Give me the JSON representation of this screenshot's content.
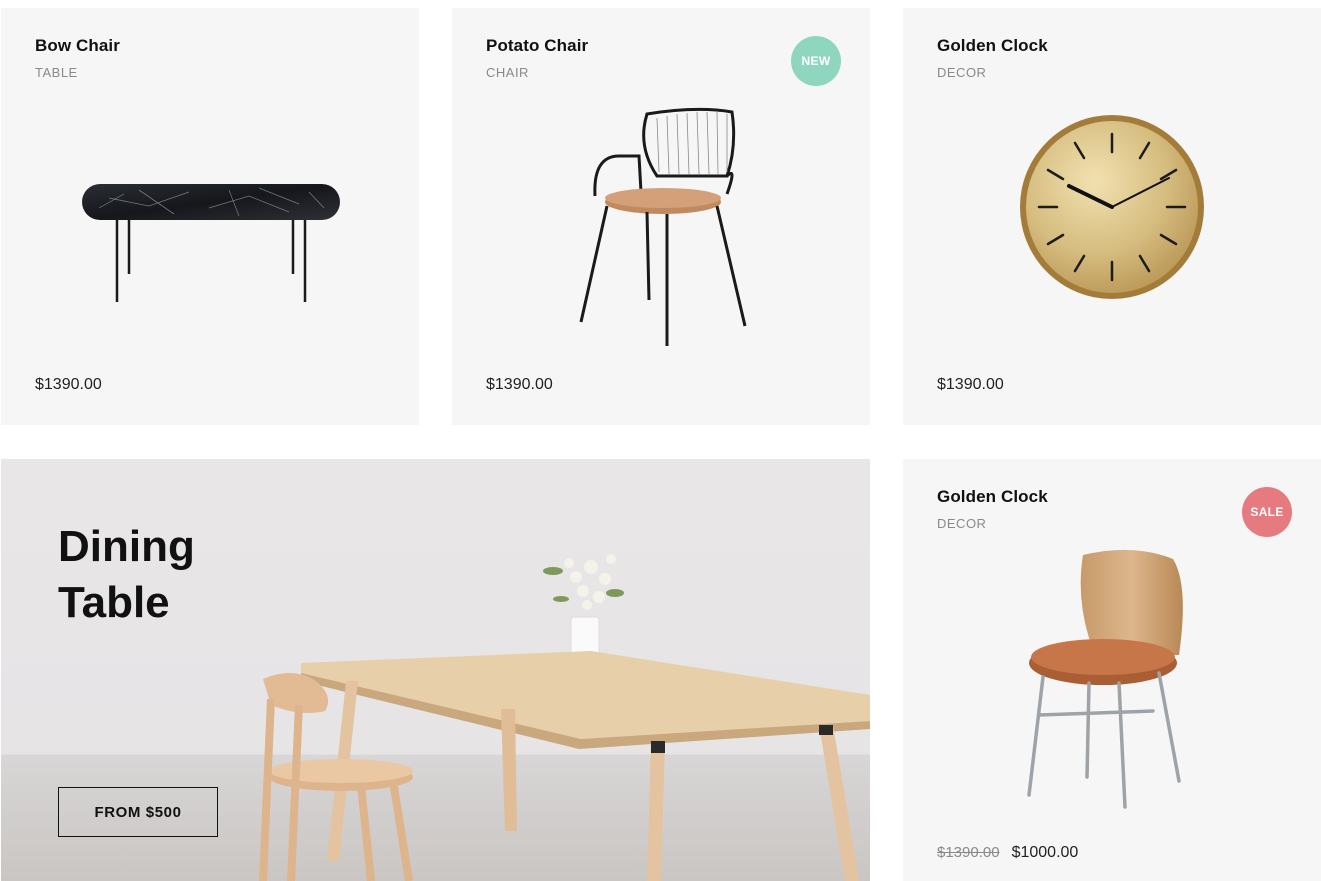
{
  "products": [
    {
      "name": "Bow Chair",
      "category": "TABLE",
      "price": "$1390.00",
      "image_icon": "marble-table-icon"
    },
    {
      "name": "Potato Chair",
      "category": "CHAIR",
      "price": "$1390.00",
      "badge": "NEW",
      "image_icon": "wire-chair-icon"
    },
    {
      "name": "Golden Clock",
      "category": "DECOR",
      "price": "$1390.00",
      "image_icon": "gold-clock-icon"
    },
    {
      "name": "Golden Clock",
      "category": "DECOR",
      "old_price": "$1390.00",
      "price": "$1000.00",
      "badge": "SALE",
      "image_icon": "wood-chair-icon"
    }
  ],
  "banner": {
    "title_line1": "Dining",
    "title_line2": "Table",
    "button_label": "FROM $500",
    "image_icon": "dining-table-photo"
  },
  "colors": {
    "card_bg": "#f6f6f6",
    "new_badge": "#8fd6be",
    "sale_badge": "#e57b7f",
    "banner_bg": "#e8e6e7"
  }
}
